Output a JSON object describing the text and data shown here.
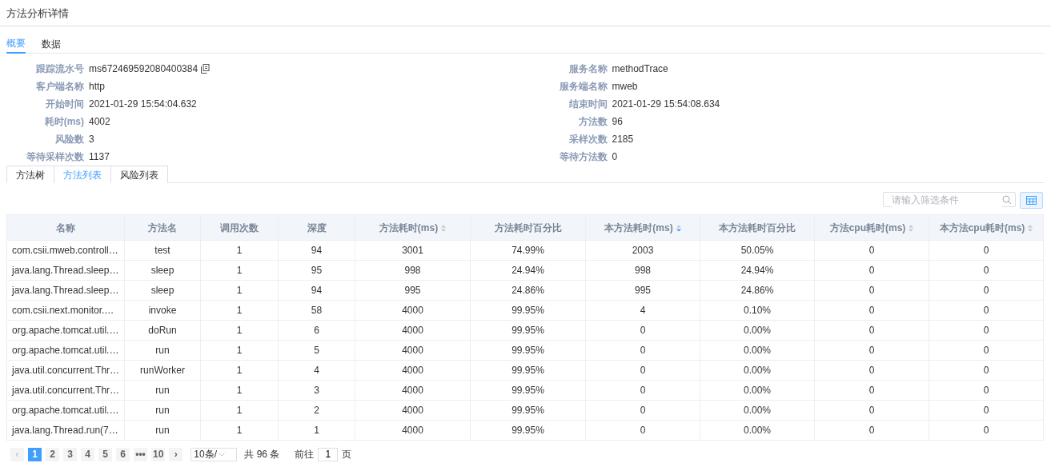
{
  "page_title": "方法分析详情",
  "tabs": [
    {
      "label": "概要",
      "selected": true
    },
    {
      "label": "数据",
      "selected": false
    }
  ],
  "summary_left": [
    {
      "label": "跟踪流水号",
      "value": "ms672469592080400384",
      "copyable": true
    },
    {
      "label": "客户端名称",
      "value": "http",
      "copyable": false
    },
    {
      "label": "开始时间",
      "value": "2021-01-29 15:54:04.632",
      "copyable": false
    },
    {
      "label": "耗时(ms)",
      "value": "4002",
      "copyable": false
    },
    {
      "label": "风险数",
      "value": "3",
      "copyable": false
    },
    {
      "label": "等待采样次数",
      "value": "1137",
      "copyable": false
    }
  ],
  "summary_right": [
    {
      "label": "服务名称",
      "value": "methodTrace"
    },
    {
      "label": "服务端名称",
      "value": "mweb"
    },
    {
      "label": "结束时间",
      "value": "2021-01-29 15:54:08.634"
    },
    {
      "label": "方法数",
      "value": "96"
    },
    {
      "label": "采样次数",
      "value": "2185"
    },
    {
      "label": "等待方法数",
      "value": "0"
    }
  ],
  "sub_tabs": [
    {
      "label": "方法树",
      "selected": false
    },
    {
      "label": "方法列表",
      "selected": true
    },
    {
      "label": "风险列表",
      "selected": false
    }
  ],
  "filter": {
    "placeholder": "请输入筛选条件"
  },
  "table": {
    "columns": [
      {
        "label": "名称",
        "sortable": false
      },
      {
        "label": "方法名",
        "sortable": false
      },
      {
        "label": "调用次数",
        "sortable": false
      },
      {
        "label": "深度",
        "sortable": false
      },
      {
        "label": "方法耗时(ms)",
        "sortable": true,
        "sorted_desc": false
      },
      {
        "label": "方法耗时百分比",
        "sortable": false
      },
      {
        "label": "本方法耗时(ms)",
        "sortable": true,
        "sorted_desc": true
      },
      {
        "label": "本方法耗时百分比",
        "sortable": false
      },
      {
        "label": "方法cpu耗时(ms)",
        "sortable": true,
        "sorted_desc": false
      },
      {
        "label": "本方法cpu耗时(ms)",
        "sortable": true,
        "sorted_desc": false
      }
    ],
    "rows": [
      [
        "com.csii.mweb.controll…",
        "test",
        "1",
        "94",
        "3001",
        "74.99%",
        "2003",
        "50.05%",
        "0",
        "0"
      ],
      [
        "java.lang.Thread.sleep…",
        "sleep",
        "1",
        "95",
        "998",
        "24.94%",
        "998",
        "24.94%",
        "0",
        "0"
      ],
      [
        "java.lang.Thread.sleep…",
        "sleep",
        "1",
        "94",
        "995",
        "24.86%",
        "995",
        "24.86%",
        "0",
        "0"
      ],
      [
        "com.csii.next.monitor.…",
        "invoke",
        "1",
        "58",
        "4000",
        "99.95%",
        "4",
        "0.10%",
        "0",
        "0"
      ],
      [
        "org.apache.tomcat.util.…",
        "doRun",
        "1",
        "6",
        "4000",
        "99.95%",
        "0",
        "0.00%",
        "0",
        "0"
      ],
      [
        "org.apache.tomcat.util.…",
        "run",
        "1",
        "5",
        "4000",
        "99.95%",
        "0",
        "0.00%",
        "0",
        "0"
      ],
      [
        "java.util.concurrent.Thr…",
        "runWorker",
        "1",
        "4",
        "4000",
        "99.95%",
        "0",
        "0.00%",
        "0",
        "0"
      ],
      [
        "java.util.concurrent.Thr…",
        "run",
        "1",
        "3",
        "4000",
        "99.95%",
        "0",
        "0.00%",
        "0",
        "0"
      ],
      [
        "org.apache.tomcat.util.…",
        "run",
        "1",
        "2",
        "4000",
        "99.95%",
        "0",
        "0.00%",
        "0",
        "0"
      ],
      [
        "java.lang.Thread.run(7…",
        "run",
        "1",
        "1",
        "4000",
        "99.95%",
        "0",
        "0.00%",
        "0",
        "0"
      ]
    ]
  },
  "pagination": {
    "pages": [
      {
        "label": "1",
        "selected": true
      },
      {
        "label": "2",
        "selected": false
      },
      {
        "label": "3",
        "selected": false
      },
      {
        "label": "4",
        "selected": false
      },
      {
        "label": "5",
        "selected": false
      },
      {
        "label": "6",
        "selected": false
      },
      {
        "label": "•••",
        "selected": false
      },
      {
        "label": "10",
        "selected": false
      }
    ],
    "prev": "‹",
    "next": "›",
    "page_size": "10条/",
    "total": "共 96 条",
    "goto_label": "前往",
    "goto_value": "1",
    "goto_suffix": "页"
  }
}
